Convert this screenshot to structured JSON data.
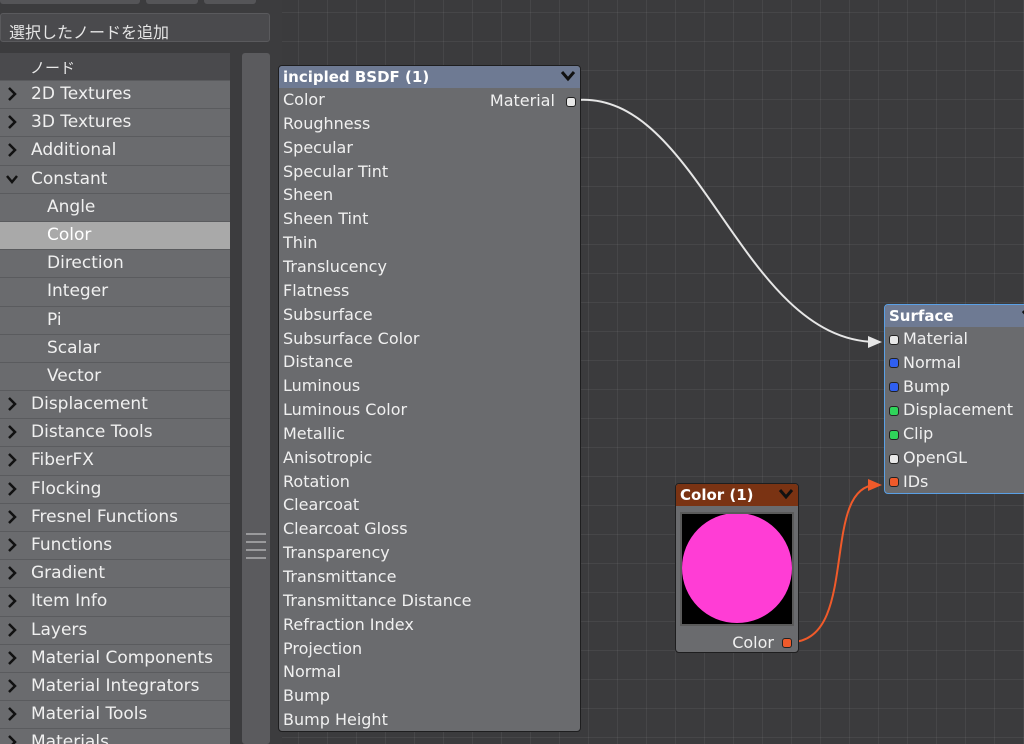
{
  "browser": {
    "add_selected_label": "選択したノードを追加",
    "header_label": "ノード",
    "items": [
      {
        "label": "2D Textures",
        "kind": "category",
        "expanded": false
      },
      {
        "label": "3D Textures",
        "kind": "category",
        "expanded": false
      },
      {
        "label": "Additional",
        "kind": "category",
        "expanded": false
      },
      {
        "label": "Constant",
        "kind": "category",
        "expanded": true
      },
      {
        "label": "Angle",
        "kind": "child"
      },
      {
        "label": "Color",
        "kind": "child",
        "selected": true
      },
      {
        "label": "Direction",
        "kind": "child"
      },
      {
        "label": "Integer",
        "kind": "child"
      },
      {
        "label": "Pi",
        "kind": "child"
      },
      {
        "label": "Scalar",
        "kind": "child"
      },
      {
        "label": "Vector",
        "kind": "child"
      },
      {
        "label": "Displacement",
        "kind": "category",
        "expanded": false
      },
      {
        "label": "Distance Tools",
        "kind": "category",
        "expanded": false
      },
      {
        "label": "FiberFX",
        "kind": "category",
        "expanded": false
      },
      {
        "label": "Flocking",
        "kind": "category",
        "expanded": false
      },
      {
        "label": "Fresnel Functions",
        "kind": "category",
        "expanded": false
      },
      {
        "label": "Functions",
        "kind": "category",
        "expanded": false
      },
      {
        "label": "Gradient",
        "kind": "category",
        "expanded": false
      },
      {
        "label": "Item Info",
        "kind": "category",
        "expanded": false
      },
      {
        "label": "Layers",
        "kind": "category",
        "expanded": false
      },
      {
        "label": "Material Components",
        "kind": "category",
        "expanded": false
      },
      {
        "label": "Material Integrators",
        "kind": "category",
        "expanded": false
      },
      {
        "label": "Material Tools",
        "kind": "category",
        "expanded": false
      },
      {
        "label": "Materials",
        "kind": "category",
        "expanded": false
      }
    ]
  },
  "nodes": {
    "principled": {
      "title": "incipled BSDF (1)",
      "output_label": "Material",
      "inputs": [
        "Color",
        "Roughness",
        "Specular",
        "Specular Tint",
        "Sheen",
        "Sheen Tint",
        "Thin",
        "Translucency",
        "Flatness",
        "Subsurface",
        "Subsurface Color",
        "Distance",
        "Luminous",
        "Luminous Color",
        "Metallic",
        "Anisotropic",
        "Rotation",
        "Clearcoat",
        "Clearcoat Gloss",
        "Transparency",
        "Transmittance",
        "Transmittance Distance",
        "Refraction Index",
        "Projection",
        "Normal",
        "Bump",
        "Bump Height"
      ]
    },
    "surface": {
      "title": "Surface",
      "inputs": [
        {
          "label": "Material",
          "color": "#e8e8e8"
        },
        {
          "label": "Normal",
          "color": "#2f5ff0"
        },
        {
          "label": "Bump",
          "color": "#2f5ff0"
        },
        {
          "label": "Displacement",
          "color": "#2fd45a"
        },
        {
          "label": "Clip",
          "color": "#2fd45a"
        },
        {
          "label": "OpenGL",
          "color": "#e8e8e8"
        },
        {
          "label": "IDs",
          "color": "#f05a2a"
        }
      ]
    },
    "color": {
      "title": "Color (1)",
      "output_label": "Color",
      "swatch_color": "#ff3dd5",
      "output_color": "#f05a2a"
    }
  },
  "colors": {
    "wire_white": "#e6e6e6",
    "wire_orange": "#f05a2a",
    "node_header": "#6e7a93",
    "color_node_header": "#7a3313",
    "selection_border": "#5aa0e6"
  }
}
